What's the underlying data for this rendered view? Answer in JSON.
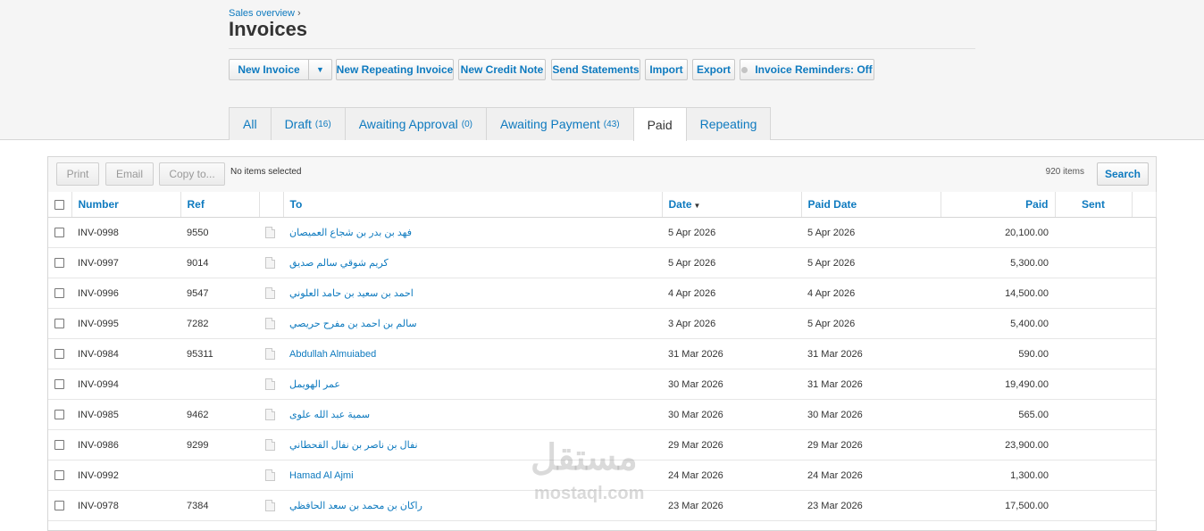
{
  "breadcrumb": {
    "link": "Sales overview",
    "separator": "›"
  },
  "page_title": "Invoices",
  "actions": {
    "new_invoice": "New Invoice",
    "new_repeating_invoice": "New Repeating Invoice",
    "new_credit_note": "New Credit Note",
    "send_statements": "Send Statements",
    "import": "Import",
    "export": "Export",
    "invoice_reminders": "Invoice Reminders: Off"
  },
  "tabs": [
    {
      "label": "All",
      "count": ""
    },
    {
      "label": "Draft",
      "count": "(16)"
    },
    {
      "label": "Awaiting Approval",
      "count": "(0)"
    },
    {
      "label": "Awaiting Payment",
      "count": "(43)"
    },
    {
      "label": "Paid",
      "count": ""
    },
    {
      "label": "Repeating",
      "count": ""
    }
  ],
  "active_tab": "Paid",
  "toolbar": {
    "print": "Print",
    "email": "Email",
    "copy_to": "Copy to...",
    "selection_status": "No items selected",
    "item_count": "920 items",
    "search": "Search"
  },
  "table": {
    "columns": {
      "number": "Number",
      "ref": "Ref",
      "to": "To",
      "date": "Date",
      "paid_date": "Paid Date",
      "paid": "Paid",
      "sent": "Sent"
    },
    "sorted_by": "Date",
    "rows": [
      {
        "number": "INV-0998",
        "ref": "9550",
        "to": "فهد بن بدر بن شجاع العميصان",
        "date": "5 Apr 2026",
        "paid_date": "5 Apr 2026",
        "paid": "20,100.00",
        "sent": ""
      },
      {
        "number": "INV-0997",
        "ref": "9014",
        "to": "كريم شوقي سالم صديق",
        "date": "5 Apr 2026",
        "paid_date": "5 Apr 2026",
        "paid": "5,300.00",
        "sent": ""
      },
      {
        "number": "INV-0996",
        "ref": "9547",
        "to": "احمد بن سعيد بن حامد العلوني",
        "date": "4 Apr 2026",
        "paid_date": "4 Apr 2026",
        "paid": "14,500.00",
        "sent": ""
      },
      {
        "number": "INV-0995",
        "ref": "7282",
        "to": "سالم بن احمد بن مفرح حريصي",
        "date": "3 Apr 2026",
        "paid_date": "5 Apr 2026",
        "paid": "5,400.00",
        "sent": ""
      },
      {
        "number": "INV-0984",
        "ref": "95311",
        "to": "Abdullah Almuiabed",
        "date": "31 Mar 2026",
        "paid_date": "31 Mar 2026",
        "paid": "590.00",
        "sent": ""
      },
      {
        "number": "INV-0994",
        "ref": "",
        "to": "عمر الهويمل",
        "date": "30 Mar 2026",
        "paid_date": "31 Mar 2026",
        "paid": "19,490.00",
        "sent": ""
      },
      {
        "number": "INV-0985",
        "ref": "9462",
        "to": "سمية عبد الله علوى",
        "date": "30 Mar 2026",
        "paid_date": "30 Mar 2026",
        "paid": "565.00",
        "sent": ""
      },
      {
        "number": "INV-0986",
        "ref": "9299",
        "to": "نفال بن ناصر بن نفال القحطاني",
        "date": "29 Mar 2026",
        "paid_date": "29 Mar 2026",
        "paid": "23,900.00",
        "sent": ""
      },
      {
        "number": "INV-0992",
        "ref": "",
        "to": "Hamad Al Ajmi",
        "date": "24 Mar 2026",
        "paid_date": "24 Mar 2026",
        "paid": "1,300.00",
        "sent": ""
      },
      {
        "number": "INV-0978",
        "ref": "7384",
        "to": "راكان بن محمد بن سعد الحافظي",
        "date": "23 Mar 2026",
        "paid_date": "23 Mar 2026",
        "paid": "17,500.00",
        "sent": ""
      }
    ]
  },
  "watermark": {
    "arabic": "مستقل",
    "latin": "mostaql.com"
  },
  "colors": {
    "link": "#0e7abf",
    "text": "#333333",
    "border": "#d6d6d6"
  }
}
